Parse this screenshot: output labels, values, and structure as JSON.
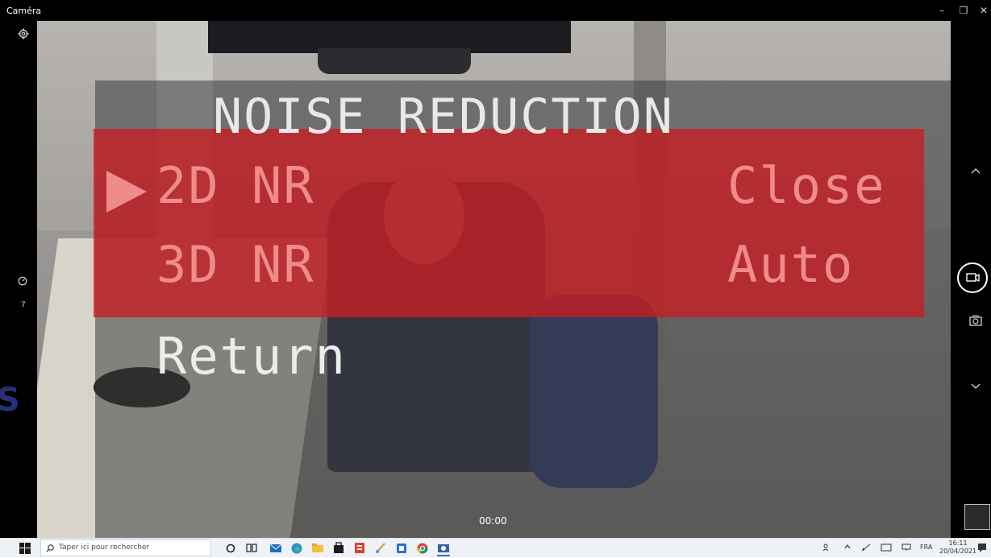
{
  "window": {
    "title": "Caméra",
    "controls": {
      "minimize": "–",
      "maximize": "❐",
      "close": "✕"
    }
  },
  "left_rail": {
    "settings_icon": "gear-icon",
    "timer_icon": "timer-icon",
    "timer_value": "7"
  },
  "osd": {
    "title": "NOISE REDUCTION",
    "items": [
      {
        "label": "2D NR",
        "value": "Close",
        "selected": true
      },
      {
        "label": "3D NR",
        "value": "Auto",
        "selected": false
      }
    ],
    "return_label": "Return",
    "highlight_color": "#c81c22"
  },
  "recording": {
    "time": "00:00"
  },
  "right_rail": {
    "up_icon": "chevron-up-icon",
    "video_icon": "video-camera-icon",
    "photo_icon": "camera-icon",
    "down_icon": "chevron-down-icon"
  },
  "side_glyph": "S",
  "taskbar": {
    "search_placeholder": "Taper ici pour rechercher",
    "language": "FRA",
    "time": "16:11",
    "date": "20/04/2021",
    "apps": [
      "cortana-icon",
      "task-view-icon",
      "mail-icon",
      "edge-icon",
      "file-explorer-icon",
      "store-icon",
      "office-icon",
      "paint-icon",
      "calendar-icon",
      "chrome-icon",
      "camera-app-icon"
    ]
  }
}
